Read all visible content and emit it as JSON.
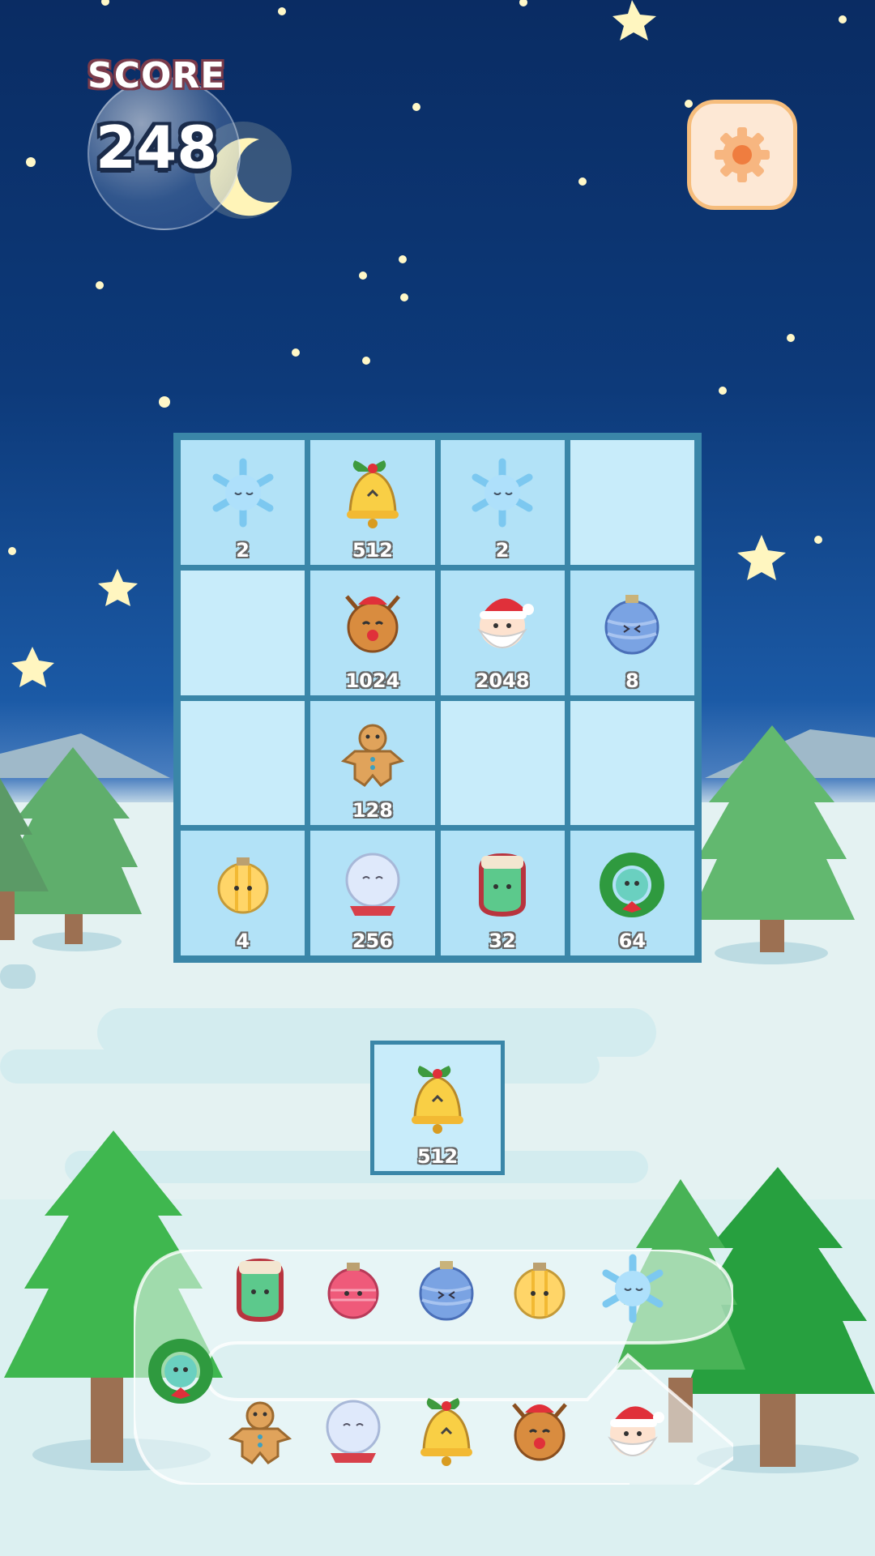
{
  "score": {
    "label": "SCORE",
    "value": "248"
  },
  "settings": {
    "icon": "gear-icon"
  },
  "board": {
    "rows": [
      [
        {
          "item": "snowflake",
          "value": "2"
        },
        {
          "item": "bell",
          "value": "512"
        },
        {
          "item": "snowflake",
          "value": "2"
        },
        {
          "item": "",
          "value": ""
        }
      ],
      [
        {
          "item": "",
          "value": ""
        },
        {
          "item": "reindeer",
          "value": "1024"
        },
        {
          "item": "santa",
          "value": "2048"
        },
        {
          "item": "blue-ornament",
          "value": "8"
        }
      ],
      [
        {
          "item": "",
          "value": ""
        },
        {
          "item": "gingerbread",
          "value": "128"
        },
        {
          "item": "",
          "value": ""
        },
        {
          "item": "",
          "value": ""
        }
      ],
      [
        {
          "item": "gold-ornament",
          "value": "4"
        },
        {
          "item": "snow-globe",
          "value": "256"
        },
        {
          "item": "mitten",
          "value": "32"
        },
        {
          "item": "wreath",
          "value": "64"
        }
      ]
    ]
  },
  "next_tile": {
    "item": "bell",
    "value": "512"
  },
  "tray": {
    "top_row": [
      "mitten",
      "pink-ornament",
      "blue-ornament",
      "gold-ornament",
      "snowflake"
    ],
    "left": "wreath",
    "bottom_row": [
      "gingerbread",
      "snow-globe",
      "bell",
      "reindeer",
      "santa"
    ]
  },
  "colors": {
    "grid_border": "#3a86a8",
    "cell_light": "#c8ecfa",
    "cell_dark": "#b2e2f7",
    "settings_bg": "#fde8d5"
  }
}
